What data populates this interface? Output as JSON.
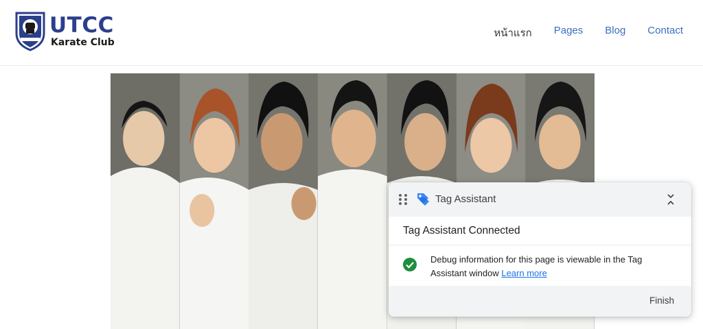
{
  "header": {
    "logo_title": "UTCC",
    "logo_subtitle": "Karate Club",
    "nav": [
      {
        "label": "หน้าแรก",
        "active": true
      },
      {
        "label": "Pages",
        "active": false
      },
      {
        "label": "Blog",
        "active": false
      },
      {
        "label": "Contact",
        "active": false
      }
    ]
  },
  "colors": {
    "brand_blue": "#2b3f8c",
    "nav_link": "#3b6fbf",
    "nav_active": "#333333",
    "success_green": "#1e8e3e",
    "link_blue": "#1a73e8"
  },
  "hero": {
    "panels": [
      "karate-member-1",
      "karate-member-2",
      "karate-member-3",
      "karate-member-4",
      "karate-member-5",
      "karate-member-6",
      "karate-member-7"
    ]
  },
  "tag_assistant": {
    "title": "Tag Assistant",
    "status": "Tag Assistant Connected",
    "message": "Debug information for this page is viewable in the Tag Assistant window",
    "link_label": "Learn more",
    "finish_label": "Finish",
    "icons": {
      "drag": "drag-handle-icon",
      "logo": "tag-assistant-logo-icon",
      "collapse": "collapse-icon",
      "status": "check-circle-icon"
    }
  }
}
